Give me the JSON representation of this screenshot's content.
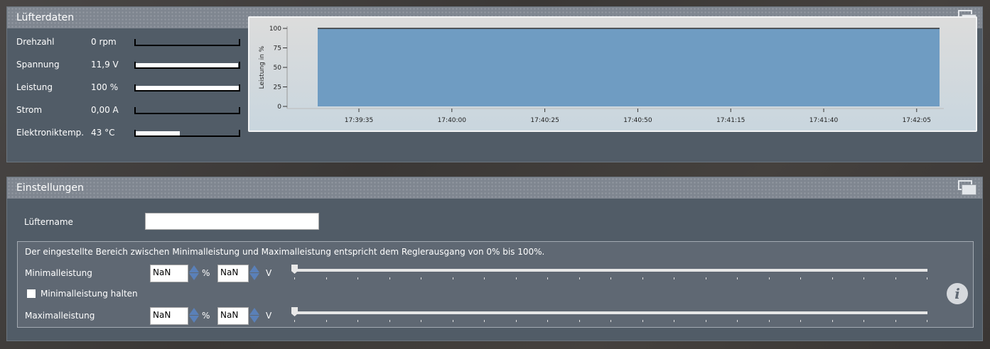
{
  "fan_data": {
    "title": "Lüfterdaten",
    "rows": [
      {
        "label": "Drehzahl",
        "value": "0 rpm",
        "fill": 0
      },
      {
        "label": "Spannung",
        "value": "11,9 V",
        "fill": 0.99
      },
      {
        "label": "Leistung",
        "value": "100 %",
        "fill": 1.0
      },
      {
        "label": "Strom",
        "value": "0,00 A",
        "fill": 0
      },
      {
        "label": "Elektroniktemp.",
        "value": "43 °C",
        "fill": 0.43
      }
    ]
  },
  "chart_data": {
    "type": "area",
    "ylabel": "Leistung in %",
    "ylim": [
      0,
      100
    ],
    "yticks": [
      "100",
      "75",
      "50",
      "25",
      "0"
    ],
    "xticks": [
      "17:39:35",
      "17:40:00",
      "17:40:25",
      "17:40:50",
      "17:41:15",
      "17:41:40",
      "17:42:05"
    ],
    "series": [
      {
        "name": "Leistung",
        "values": [
          100,
          100
        ],
        "x": [
          "17:39:24",
          "17:42:08"
        ]
      }
    ],
    "fill_color": "#6f9cc2"
  },
  "settings": {
    "title": "Einstellungen",
    "fan_name_label": "Lüftername",
    "fan_name_value": "",
    "info_text": "Der eingestellte Bereich zwischen Minimalleistung und Maximalleistung entspricht dem Reglerausgang von 0% bis 100%.",
    "min_label": "Minimalleistung",
    "min_percent": "NaN",
    "min_volt": "NaN",
    "percent_unit": "%",
    "volt_unit": "V",
    "hold_label": "Minimalleistung halten",
    "hold_checked": false,
    "max_label": "Maximalleistung",
    "max_percent": "NaN",
    "max_volt": "NaN",
    "min_slider": 0,
    "max_slider": 0,
    "info_icon": "i"
  }
}
